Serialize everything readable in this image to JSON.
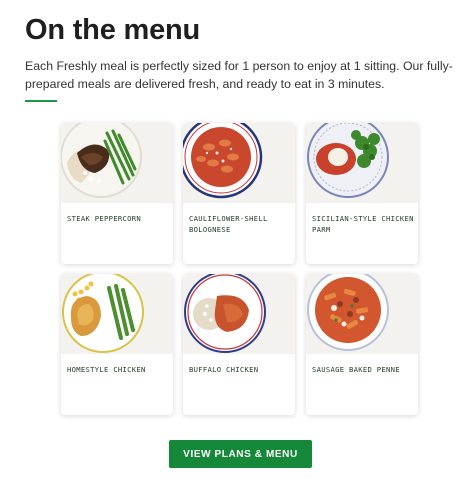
{
  "header": {
    "title": "On the menu",
    "description": "Each Freshly meal is perfectly sized for 1 person to enjoy at 1 sitting. Our fully-prepared meals are delivered fresh, and ready to eat in 3 minutes."
  },
  "meals": [
    {
      "name": "STEAK PEPPERCORN",
      "image": "steak-peppercorn-image"
    },
    {
      "name": "CAULIFLOWER-SHELL BOLOGNESE",
      "image": "cauliflower-shell-bolognese-image"
    },
    {
      "name": "SICILIAN-STYLE CHICKEN PARM",
      "image": "sicilian-style-chicken-parm-image"
    },
    {
      "name": "HOMESTYLE CHICKEN",
      "image": "homestyle-chicken-image"
    },
    {
      "name": "BUFFALO CHICKEN",
      "image": "buffalo-chicken-image"
    },
    {
      "name": "SAUSAGE BAKED PENNE",
      "image": "sausage-baked-penne-image"
    }
  ],
  "cta": {
    "label": "VIEW PLANS & MENU"
  },
  "colors": {
    "accent": "#1f9447",
    "button": "#15883a",
    "meal_name": "#1f3b25"
  }
}
